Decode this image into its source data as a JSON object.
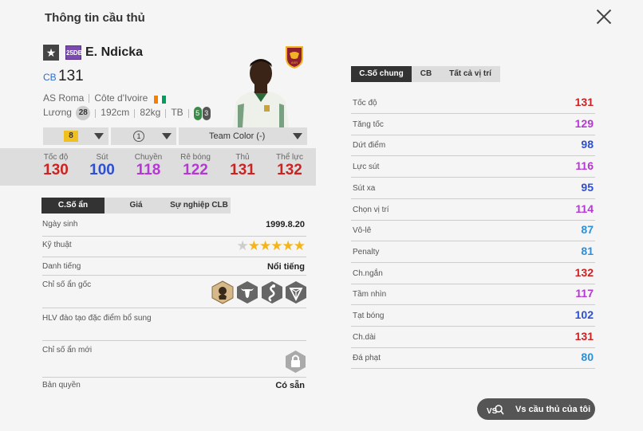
{
  "header": {
    "title": "Thông tin cầu thủ"
  },
  "player": {
    "season_badge": "25DB",
    "name": "E. Ndicka",
    "position": "CB",
    "ovr": "131",
    "club": "AS Roma",
    "nation": "Côte d'Ivoire",
    "height": "192cm",
    "weight": "82kg",
    "body_type": "TB",
    "salary_label": "Lương",
    "salary": "28",
    "left_foot": "5",
    "right_foot": "3"
  },
  "controls": {
    "upgrade_level": "8",
    "rank": "1",
    "team_color": "Team Color (-)"
  },
  "main_stats": [
    {
      "label": "Tốc độ",
      "value": "130",
      "color": "#cc2222"
    },
    {
      "label": "Sút",
      "value": "100",
      "color": "#2e4fd0"
    },
    {
      "label": "Chuyền",
      "value": "118",
      "color": "#b637d6"
    },
    {
      "label": "Rê bóng",
      "value": "122",
      "color": "#b637d6"
    },
    {
      "label": "Thủ",
      "value": "131",
      "color": "#cc2222"
    },
    {
      "label": "Thể lực",
      "value": "132",
      "color": "#cc2222"
    }
  ],
  "left_tabs": [
    "C.Số ẩn",
    "Giá",
    "Sự nghiệp CLB"
  ],
  "hidden": {
    "birth_label": "Ngày sinh",
    "birth_value": "1999.8.20",
    "skill_label": "Kỹ thuật",
    "skill_stars": 5,
    "fame_label": "Danh tiếng",
    "fame_value": "Nổi tiếng",
    "base_traits_label": "Chỉ số ẩn gốc",
    "coach_label": "HLV đào tạo đặc điểm bổ sung",
    "new_traits_label": "Chỉ số ẩn mới",
    "license_label": "Bản quyền",
    "license_value": "Có sẵn"
  },
  "right_tabs": [
    "C.Số chung",
    "CB",
    "Tất cả vị trí"
  ],
  "detail_stats": [
    {
      "label": "Tốc độ",
      "value": "131",
      "color": "#cc2222"
    },
    {
      "label": "Tăng tốc",
      "value": "129",
      "color": "#b637d6"
    },
    {
      "label": "Dứt điểm",
      "value": "98",
      "color": "#2e4fd0"
    },
    {
      "label": "Lực sút",
      "value": "116",
      "color": "#b637d6"
    },
    {
      "label": "Sút xa",
      "value": "95",
      "color": "#2e4fd0"
    },
    {
      "label": "Chọn vị trí",
      "value": "114",
      "color": "#b637d6"
    },
    {
      "label": "Vô-lê",
      "value": "87",
      "color": "#2f8fd6"
    },
    {
      "label": "Penalty",
      "value": "81",
      "color": "#2f8fd6"
    },
    {
      "label": "Ch.ngắn",
      "value": "132",
      "color": "#cc2222"
    },
    {
      "label": "Tầm nhìn",
      "value": "117",
      "color": "#b637d6"
    },
    {
      "label": "Tạt bóng",
      "value": "102",
      "color": "#2e4fd0"
    },
    {
      "label": "Ch.dài",
      "value": "131",
      "color": "#cc2222"
    },
    {
      "label": "Đá phạt",
      "value": "80",
      "color": "#2f8fd6"
    }
  ],
  "compare_button": "Vs cầu thủ của tôi"
}
